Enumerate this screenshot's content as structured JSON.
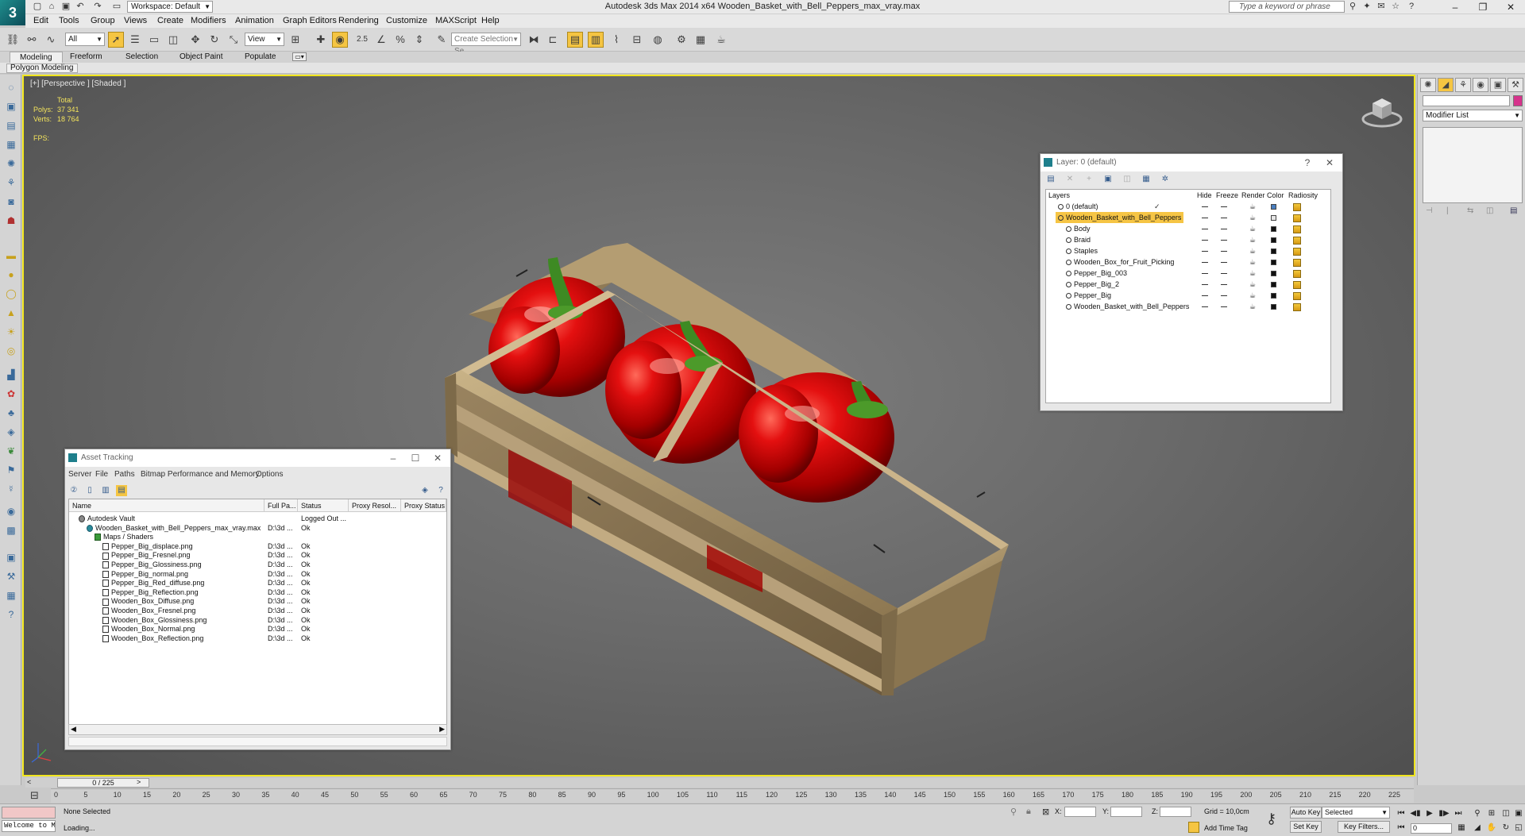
{
  "window": {
    "title": "Autodesk 3ds Max  2014 x64     Wooden_Basket_with_Bell_Peppers_max_vray.max",
    "workspace": "Workspace: Default",
    "search_placeholder": "Type a keyword or phrase"
  },
  "menu": [
    "Edit",
    "Tools",
    "Group",
    "Views",
    "Create",
    "Modifiers",
    "Animation",
    "Graph Editors",
    "Rendering",
    "Customize",
    "MAXScript",
    "Help"
  ],
  "toolbar": {
    "filter_value": "All",
    "ref_coord_value": "View",
    "selection_set_placeholder": "Create Selection Se",
    "snap_label": "2.5"
  },
  "ribbon": {
    "tabs": [
      "Modeling",
      "Freeform",
      "Selection",
      "Object Paint",
      "Populate"
    ],
    "sub_label": "Polygon Modeling"
  },
  "viewport": {
    "label": "[+] [Perspective ] [Shaded ]",
    "stats_header": "Total",
    "polys_label": "Polys:",
    "polys_value": "37 341",
    "verts_label": "Verts:",
    "verts_value": "18 764",
    "fps_label": "FPS:"
  },
  "command_panel": {
    "modifier_list": "Modifier List"
  },
  "layer_window": {
    "title": "Layer: 0 (default)",
    "help": "?",
    "columns": [
      "Layers",
      "Hide",
      "Freeze",
      "Render",
      "Color",
      "Radiosity"
    ],
    "rows": [
      {
        "name": "0 (default)",
        "indent": 1,
        "checked": true,
        "selected": false,
        "color": "#4a7fc0"
      },
      {
        "name": "Wooden_Basket_with_Bell_Peppers",
        "indent": 1,
        "checked": false,
        "selected": true,
        "color": "#e6e6e6"
      },
      {
        "name": "Body",
        "indent": 2,
        "color": "#111111"
      },
      {
        "name": "Braid",
        "indent": 2,
        "color": "#111111"
      },
      {
        "name": "Staples",
        "indent": 2,
        "color": "#111111"
      },
      {
        "name": "Wooden_Box_for_Fruit_Picking",
        "indent": 2,
        "color": "#111111"
      },
      {
        "name": "Pepper_Big_003",
        "indent": 2,
        "color": "#111111"
      },
      {
        "name": "Pepper_Big_2",
        "indent": 2,
        "color": "#111111"
      },
      {
        "name": "Pepper_Big",
        "indent": 2,
        "color": "#111111"
      },
      {
        "name": "Wooden_Basket_with_Bell_Peppers",
        "indent": 2,
        "color": "#111111"
      }
    ]
  },
  "asset_window": {
    "title": "Asset Tracking",
    "menu": [
      "Server",
      "File",
      "Paths",
      "Bitmap Performance and Memory",
      "Options"
    ],
    "columns": [
      "Name",
      "Full Pa...",
      "Status",
      "Proxy Resol...",
      "Proxy Status"
    ],
    "rows": [
      {
        "name": "Autodesk Vault",
        "indent": 1,
        "path": "",
        "status": "Logged Out ...",
        "icon": "vault"
      },
      {
        "name": "Wooden_Basket_with_Bell_Peppers_max_vray.max",
        "indent": 2,
        "path": "D:\\3d ...",
        "status": "Ok",
        "icon": "max"
      },
      {
        "name": "Maps / Shaders",
        "indent": 3,
        "path": "",
        "status": "",
        "icon": "folder"
      },
      {
        "name": "Pepper_Big_displace.png",
        "indent": 4,
        "path": "D:\\3d ...",
        "status": "Ok",
        "icon": "file"
      },
      {
        "name": "Pepper_Big_Fresnel.png",
        "indent": 4,
        "path": "D:\\3d ...",
        "status": "Ok",
        "icon": "file"
      },
      {
        "name": "Pepper_Big_Glossiness.png",
        "indent": 4,
        "path": "D:\\3d ...",
        "status": "Ok",
        "icon": "file"
      },
      {
        "name": "Pepper_Big_normal.png",
        "indent": 4,
        "path": "D:\\3d ...",
        "status": "Ok",
        "icon": "file"
      },
      {
        "name": "Pepper_Big_Red_diffuse.png",
        "indent": 4,
        "path": "D:\\3d ...",
        "status": "Ok",
        "icon": "file"
      },
      {
        "name": "Pepper_Big_Reflection.png",
        "indent": 4,
        "path": "D:\\3d ...",
        "status": "Ok",
        "icon": "file"
      },
      {
        "name": "Wooden_Box_Diffuse.png",
        "indent": 4,
        "path": "D:\\3d ...",
        "status": "Ok",
        "icon": "file"
      },
      {
        "name": "Wooden_Box_Fresnel.png",
        "indent": 4,
        "path": "D:\\3d ...",
        "status": "Ok",
        "icon": "file"
      },
      {
        "name": "Wooden_Box_Glossiness.png",
        "indent": 4,
        "path": "D:\\3d ...",
        "status": "Ok",
        "icon": "file"
      },
      {
        "name": "Wooden_Box_Normal.png",
        "indent": 4,
        "path": "D:\\3d ...",
        "status": "Ok",
        "icon": "file"
      },
      {
        "name": "Wooden_Box_Reflection.png",
        "indent": 4,
        "path": "D:\\3d ...",
        "status": "Ok",
        "icon": "file"
      }
    ]
  },
  "timeline": {
    "frame_counter": "0 / 225",
    "ticks": [
      0,
      5,
      10,
      15,
      20,
      25,
      30,
      35,
      40,
      45,
      50,
      55,
      60,
      65,
      70,
      75,
      80,
      85,
      90,
      95,
      100,
      105,
      110,
      115,
      120,
      125,
      130,
      135,
      140,
      145,
      150,
      155,
      160,
      165,
      170,
      175,
      180,
      185,
      190,
      195,
      200,
      205,
      210,
      215,
      220,
      225
    ]
  },
  "status": {
    "welcome": "Welcome to M",
    "selection": "None Selected",
    "prompt": "Loading...",
    "x_label": "X:",
    "y_label": "Y:",
    "z_label": "Z:",
    "grid": "Grid = 10,0cm",
    "add_time_tag": "Add Time Tag",
    "auto_key": "Auto Key",
    "set_key": "Set Key",
    "selected_option": "Selected",
    "key_filters": "Key Filters...",
    "frame_value": "0"
  }
}
